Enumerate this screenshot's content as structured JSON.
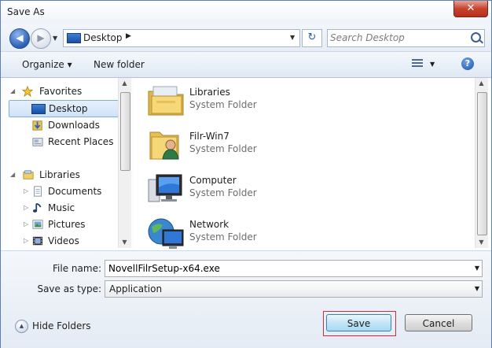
{
  "window": {
    "title": "Save As",
    "close_glyph": "✕"
  },
  "nav": {
    "back_glyph": "◀",
    "forward_glyph": "▶"
  },
  "address": {
    "location": "Desktop",
    "chevron": "▶"
  },
  "search": {
    "placeholder": "Search Desktop"
  },
  "toolbar": {
    "organize_label": "Organize ▾",
    "new_folder_label": "New folder",
    "help_glyph": "?"
  },
  "sidebar": {
    "favorites": {
      "label": "Favorites",
      "items": [
        {
          "label": "Desktop",
          "icon": "desktop-icon",
          "selected": true
        },
        {
          "label": "Downloads",
          "icon": "downloads-icon"
        },
        {
          "label": "Recent Places",
          "icon": "recent-places-icon"
        }
      ]
    },
    "libraries": {
      "label": "Libraries",
      "items": [
        {
          "label": "Documents",
          "icon": "documents-icon"
        },
        {
          "label": "Music",
          "icon": "music-icon"
        },
        {
          "label": "Pictures",
          "icon": "pictures-icon"
        },
        {
          "label": "Videos",
          "icon": "videos-icon"
        }
      ]
    }
  },
  "content": {
    "items": [
      {
        "name": "Libraries",
        "type": "System Folder",
        "icon": "libraries-folder-icon"
      },
      {
        "name": "Filr-Win7",
        "type": "System Folder",
        "icon": "user-folder-icon"
      },
      {
        "name": "Computer",
        "type": "System Folder",
        "icon": "computer-icon"
      },
      {
        "name": "Network",
        "type": "System Folder",
        "icon": "network-icon"
      }
    ]
  },
  "form": {
    "file_name_label": "File name:",
    "file_name_value": "NovellFilrSetup-x64.exe",
    "save_type_label": "Save as type:",
    "save_type_value": "Application"
  },
  "footer": {
    "hide_folders_label": "Hide Folders",
    "save_label": "Save",
    "cancel_label": "Cancel"
  },
  "colors": {
    "highlight_border": "#d6283f",
    "selection_border": "#84acdd",
    "window_border": "#5a7fb3"
  }
}
